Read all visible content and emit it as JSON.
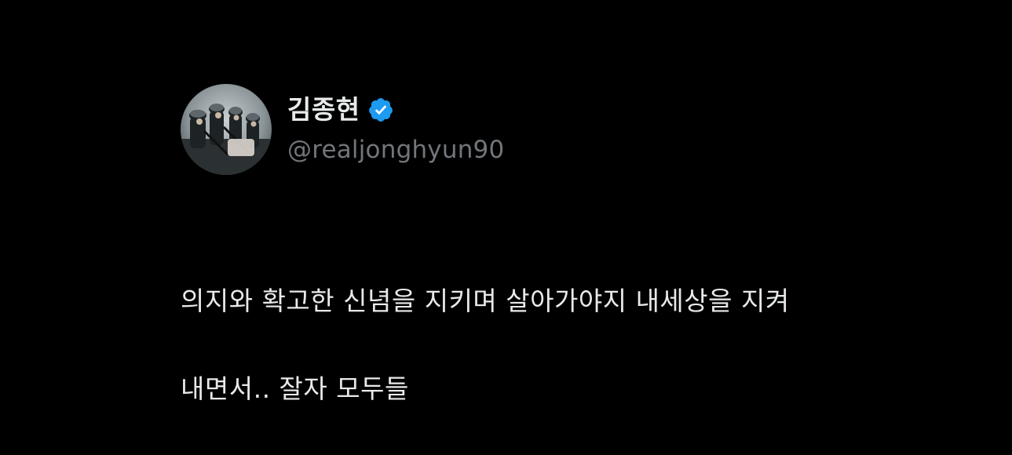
{
  "tweet": {
    "author": {
      "display_name": "김종현",
      "handle": "@realjonghyun90",
      "verified": true,
      "avatar_icon": "profile-photo-soldiers"
    },
    "text_line1": "의지와 확고한 신념을 지키며 살아가야지 내세상을 지켜",
    "text_line2": "내면서.. 잘자 모두들"
  },
  "colors": {
    "background": "#000000",
    "text_primary": "#e7e9ea",
    "text_secondary": "#71767b",
    "verified_blue": "#1d9bf0"
  }
}
